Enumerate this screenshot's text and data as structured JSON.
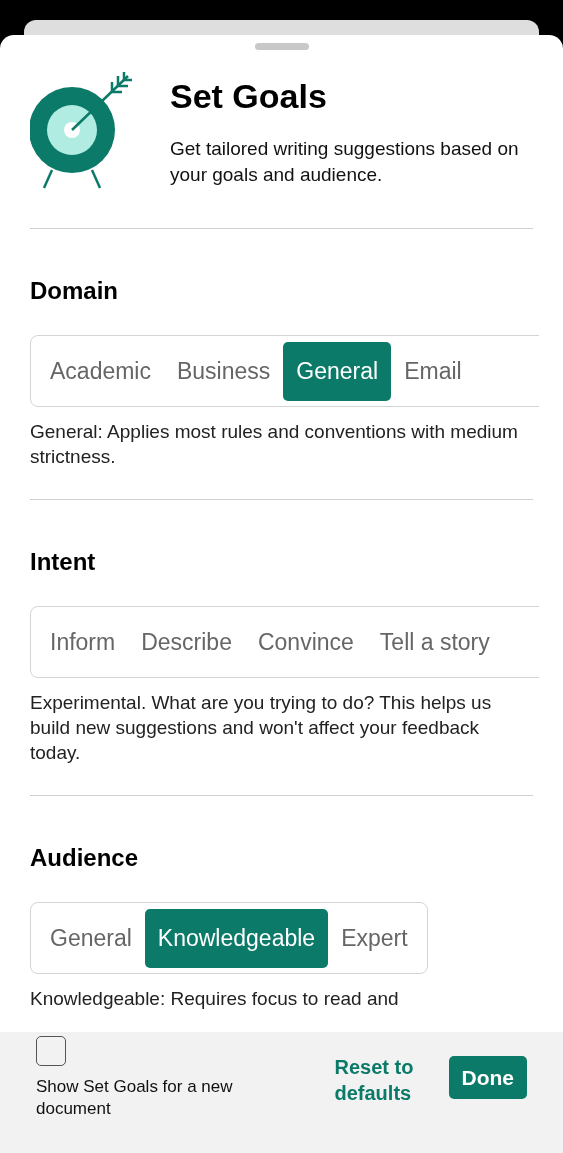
{
  "header": {
    "title": "Set Goals",
    "subtitle": "Get tailored writing suggestions based on your goals and audience."
  },
  "sections": [
    {
      "heading": "Domain",
      "options": [
        {
          "label": "Academic",
          "selected": false
        },
        {
          "label": "Business",
          "selected": false
        },
        {
          "label": "General",
          "selected": true
        },
        {
          "label": "Email",
          "selected": false
        }
      ],
      "description": "General: Applies most rules and conventions with medium strictness."
    },
    {
      "heading": "Intent",
      "options": [
        {
          "label": "Inform",
          "selected": false
        },
        {
          "label": "Describe",
          "selected": false
        },
        {
          "label": "Convince",
          "selected": false
        },
        {
          "label": "Tell a story",
          "selected": false
        }
      ],
      "description": "Experimental. What are you trying to do? This helps us build new suggestions and won't affect your feedback today."
    },
    {
      "heading": "Audience",
      "options": [
        {
          "label": "General",
          "selected": false
        },
        {
          "label": "Knowledgeable",
          "selected": true
        },
        {
          "label": "Expert",
          "selected": false
        }
      ],
      "description": "Knowledgeable: Requires focus to read and"
    }
  ],
  "footer": {
    "checkbox": {
      "label": "Show Set Goals for a new document",
      "checked": false
    },
    "reset": "Reset to defaults",
    "done": "Done"
  }
}
